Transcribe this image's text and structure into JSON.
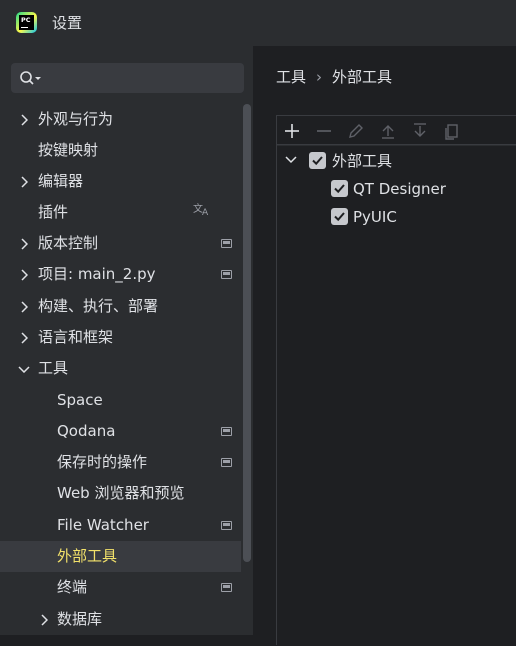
{
  "window": {
    "title": "设置",
    "app_icon": "pycharm-logo"
  },
  "sidebar": {
    "search": {
      "value": "",
      "placeholder": ""
    },
    "items": [
      {
        "label": "外观与行为",
        "expandable": true,
        "expanded": false
      },
      {
        "label": "按键映射",
        "expandable": false
      },
      {
        "label": "编辑器",
        "expandable": true,
        "expanded": false
      },
      {
        "label": "插件",
        "expandable": false,
        "badge": "translate-icon"
      },
      {
        "label": "版本控制",
        "expandable": true,
        "expanded": false,
        "badge": "project-level-icon"
      },
      {
        "label": "项目: main_2.py",
        "expandable": true,
        "expanded": false,
        "badge": "project-level-icon"
      },
      {
        "label": "构建、执行、部署",
        "expandable": true,
        "expanded": false
      },
      {
        "label": "语言和框架",
        "expandable": true,
        "expanded": false
      },
      {
        "label": "工具",
        "expandable": true,
        "expanded": true
      },
      {
        "label": "Space",
        "child": true
      },
      {
        "label": "Qodana",
        "child": true,
        "badge": "project-level-icon"
      },
      {
        "label": "保存时的操作",
        "child": true,
        "badge": "project-level-icon"
      },
      {
        "label": "Web 浏览器和预览",
        "child": true
      },
      {
        "label": "File Watcher",
        "child": true,
        "badge": "project-level-icon"
      },
      {
        "label": "外部工具",
        "child": true,
        "selected": true
      },
      {
        "label": "终端",
        "child": true,
        "badge": "project-level-icon"
      },
      {
        "label": "数据库",
        "child": true,
        "expandable": true,
        "expanded": false
      }
    ]
  },
  "breadcrumb": {
    "parent": "工具",
    "current": "外部工具"
  },
  "toolbar": {
    "buttons": [
      "add-icon",
      "remove-icon",
      "edit-icon",
      "move-up-icon",
      "move-down-icon",
      "copy-icon"
    ]
  },
  "external_tools": {
    "group": {
      "label": "外部工具",
      "checked": true,
      "expanded": true
    },
    "tools": [
      {
        "label": "QT Designer",
        "checked": true
      },
      {
        "label": "PyUIC",
        "checked": true
      }
    ]
  },
  "colors": {
    "accent_selected_text": "#f2e16a",
    "sidebar_bg": "#2b2d30",
    "main_bg": "#1e1f22"
  }
}
